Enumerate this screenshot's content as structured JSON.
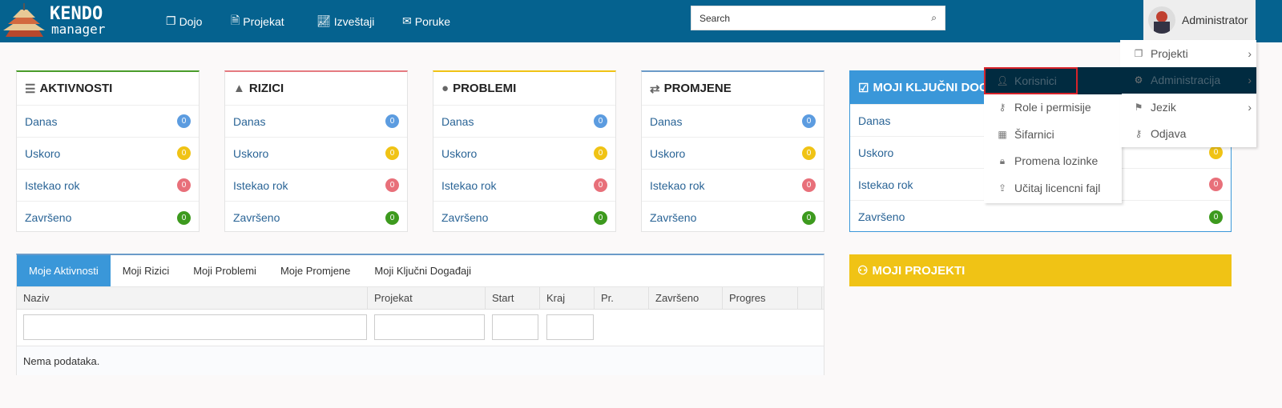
{
  "header": {
    "logo_text": "KENDO manager",
    "nav": [
      {
        "label": "Dojo",
        "icon": "copy-icon"
      },
      {
        "label": "Projekat",
        "icon": "file-icon"
      },
      {
        "label": "Izveštaji",
        "icon": "chart-icon"
      },
      {
        "label": "Poruke",
        "icon": "envelope-icon"
      }
    ],
    "search_placeholder": "Search",
    "user": "Administrator"
  },
  "cards": [
    {
      "title": "AKTIVNOSTI",
      "icon": "list-icon",
      "color": "#4a9d2a"
    },
    {
      "title": "RIZICI",
      "icon": "warning-icon",
      "color": "#e57a80"
    },
    {
      "title": "PROBLEMI",
      "icon": "exclamation-icon",
      "color": "#f0c315"
    },
    {
      "title": "PROMJENE",
      "icon": "exchange-icon",
      "color": "#6b9bc9"
    },
    {
      "title": "MOJI KLJUČNI DOGAĐAJI",
      "icon": "check-square-icon",
      "color": "#3a97d9"
    }
  ],
  "rows": [
    {
      "label": "Danas",
      "count": "0",
      "color": "#5c9ce0"
    },
    {
      "label": "Uskoro",
      "count": "0",
      "color": "#f0c315"
    },
    {
      "label": "Istekao rok",
      "count": "0",
      "color": "#e8707a"
    },
    {
      "label": "Završeno",
      "count": "0",
      "color": "#3d9a1e"
    }
  ],
  "tabs": [
    "Moje Aktivnosti",
    "Moji Rizici",
    "Moji Problemi",
    "Moje Promjene",
    "Moji Ključni Događaji"
  ],
  "columns": [
    "Naziv",
    "Projekat",
    "Start",
    "Kraj",
    "Pr.",
    "Završeno",
    "Progres"
  ],
  "no_data": "Nema podataka.",
  "projects_title": "MOJI PROJEKTI",
  "user_menu": [
    {
      "label": "Projekti",
      "icon": "files-icon",
      "submenu": true
    },
    {
      "label": "Administracija",
      "icon": "cubes-icon",
      "submenu": true,
      "active": true
    },
    {
      "label": "Jezik",
      "icon": "flag-icon",
      "submenu": true
    },
    {
      "label": "Odjava",
      "icon": "key-icon"
    }
  ],
  "admin_submenu": [
    {
      "label": "Korisnici",
      "icon": "user-icon",
      "active": true
    },
    {
      "label": "Role i permisije",
      "icon": "key-icon"
    },
    {
      "label": "Šifarnici",
      "icon": "table-icon"
    },
    {
      "label": "Promena lozinke",
      "icon": "lock-icon"
    },
    {
      "label": "Učitaj licencni fajl",
      "icon": "upload-icon"
    }
  ]
}
